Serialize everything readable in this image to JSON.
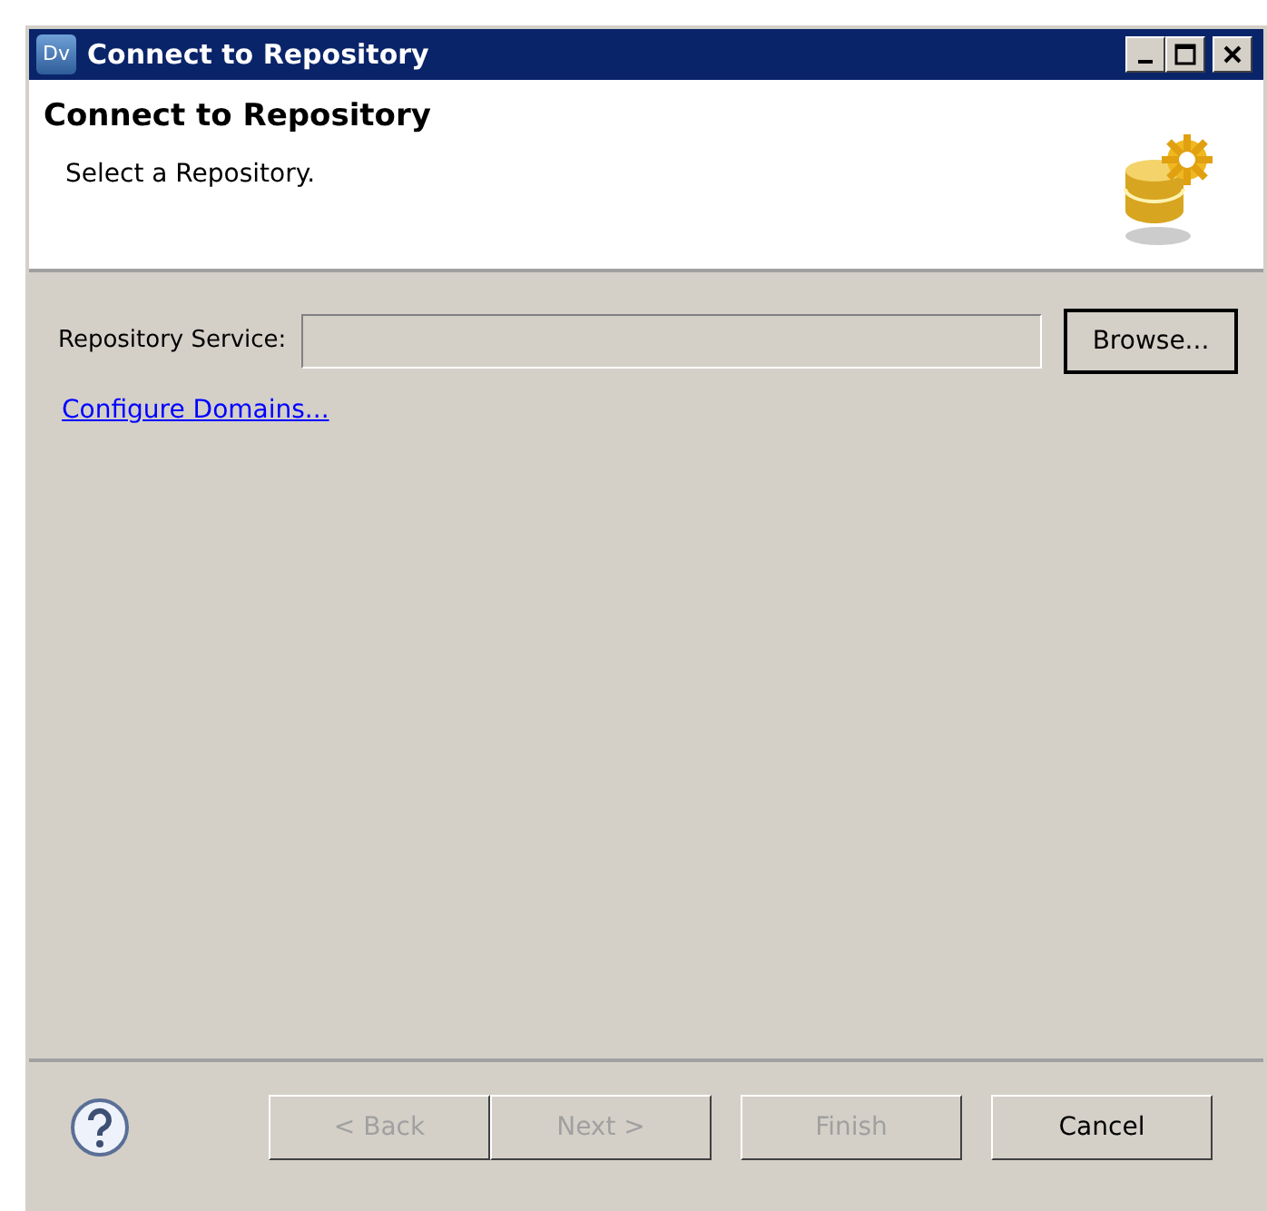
{
  "window": {
    "title": "Connect to Repository",
    "app_badge": "Dv"
  },
  "header": {
    "title": "Connect to Repository",
    "subtitle": "Select a Repository."
  },
  "form": {
    "label": "Repository Service:",
    "field_disabled": true,
    "browse": "Browse...",
    "link": "Configure Domains..."
  },
  "buttons": [
    {
      "label": "< Back",
      "disabled": true
    },
    {
      "label": "Next >",
      "disabled": true
    },
    {
      "label": "Finish",
      "disabled": true
    },
    {
      "label": "Cancel",
      "disabled": false
    }
  ]
}
